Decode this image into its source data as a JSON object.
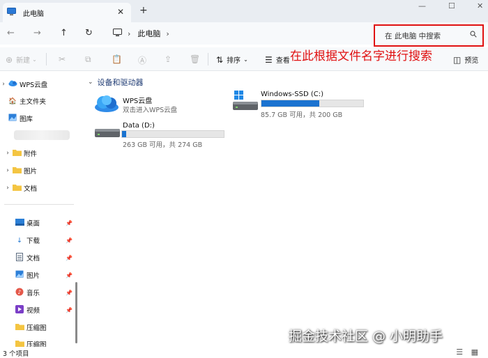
{
  "tab": {
    "title": "此电脑",
    "close": "✕",
    "new_tab": "+"
  },
  "window_controls": {
    "minimize": "—",
    "maximize": "☐",
    "close": "✕"
  },
  "nav": {
    "back": "←",
    "forward": "→",
    "up": "↑",
    "refresh": "↻"
  },
  "address": {
    "location": "此电脑"
  },
  "search": {
    "placeholder": "在 此电脑 中搜索"
  },
  "toolbar": {
    "new_label": "新建",
    "sort_label": "排序",
    "view_label": "查看",
    "preview_label": "预览"
  },
  "annotation": "在此根据文件名字进行搜索",
  "sidebar": {
    "items": [
      {
        "label": "WPS云盘",
        "icon": "cloud-icon"
      },
      {
        "label": "主文件夹",
        "icon": "home-icon"
      },
      {
        "label": "图库",
        "icon": "gallery-icon"
      },
      {
        "label": "附件",
        "icon": "folder-icon"
      },
      {
        "label": "图片",
        "icon": "folder-icon"
      },
      {
        "label": "文档",
        "icon": "folder-icon"
      },
      {
        "label": "桌面",
        "icon": "desktop-icon"
      },
      {
        "label": "下载",
        "icon": "download-icon"
      },
      {
        "label": "文档",
        "icon": "document-icon"
      },
      {
        "label": "图片",
        "icon": "picture-icon"
      },
      {
        "label": "音乐",
        "icon": "music-icon"
      },
      {
        "label": "视频",
        "icon": "video-icon"
      },
      {
        "label": "压缩图",
        "icon": "folder-icon"
      },
      {
        "label": "压缩图",
        "icon": "folder-icon"
      }
    ]
  },
  "content": {
    "section_title": "设备和驱动器",
    "drives": [
      {
        "name": "WPS云盘",
        "subtitle": "双击进入WPS云盘",
        "icon": "cloud-drive-icon"
      },
      {
        "name": "Windows-SSD (C:)",
        "subtitle": "85.7 GB 可用，共 200 GB",
        "used_fraction": 0.571,
        "icon": "windows-drive-icon"
      },
      {
        "name": "Data (D:)",
        "subtitle": "263 GB 可用，共 274 GB",
        "used_fraction": 0.04,
        "icon": "drive-icon"
      }
    ]
  },
  "status": {
    "items_count": "3 个项目"
  },
  "watermark": "掘金技术社区 @ 小明助手",
  "colors": {
    "accent": "#1a73d0",
    "annotation_red": "#e01010",
    "section_title": "#1f3b73"
  }
}
